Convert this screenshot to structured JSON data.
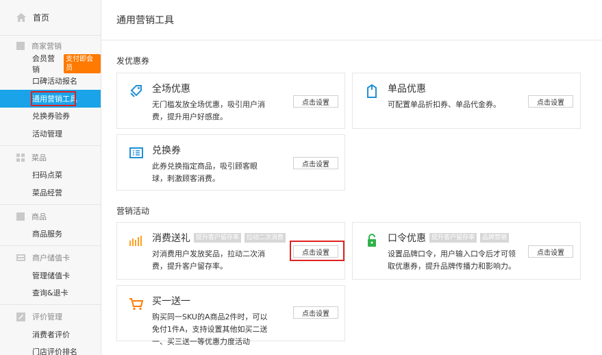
{
  "sidebar": {
    "home": "首页",
    "groups": [
      {
        "title": "商家营销",
        "items": [
          "会员营销",
          "口碑活动报名",
          "通用营销工具",
          "兑换券验券",
          "活动管理"
        ],
        "badge": "支付即会员"
      },
      {
        "title": "菜品",
        "items": [
          "扫码点菜",
          "菜品经营"
        ]
      },
      {
        "title": "商品",
        "items": [
          "商品服务"
        ]
      },
      {
        "title": "商户储值卡",
        "items": [
          "管理储值卡",
          "查询&退卡"
        ]
      },
      {
        "title": "评价管理",
        "items": [
          "消费者评价",
          "门店评价排名"
        ]
      }
    ]
  },
  "main": {
    "title": "通用营销工具",
    "sections": [
      {
        "title": "发优惠券",
        "cards": [
          {
            "title": "全场优惠",
            "desc": "无门槛发放全场优惠，吸引用户消费，提升用户好感度。",
            "button": "点击设置",
            "icon": "tag-icon"
          },
          {
            "title": "单品优惠",
            "desc": "可配置单品折扣券、单品代金券。",
            "button": "点击设置",
            "icon": "cup-icon"
          },
          {
            "title": "兑换券",
            "desc": "此券兑换指定商品，吸引顾客眼球，刺激顾客消费。",
            "button": "点击设置",
            "icon": "ticket-icon"
          }
        ]
      },
      {
        "title": "营销活动",
        "cards": [
          {
            "title": "消费送礼",
            "tags": [
              "提升客户留存率",
              "拉动二次消费"
            ],
            "desc": "对消费用户发放奖品，拉动二次消费，提升客户留存率。",
            "button": "点击设置",
            "icon": "bars-icon"
          },
          {
            "title": "口令优惠",
            "tags": [
              "提升客户留存率",
              "品牌营销"
            ],
            "desc": "设置品牌口令，用户输入口令后才可领取优惠券，提升品牌传播力和影响力。",
            "button": "点击设置",
            "icon": "lock-icon"
          },
          {
            "title": "买一送一",
            "desc": "购买同一SKU的A商品2件时，可以免付1件A，支持设置其他如买二送一、买三送一等优惠力度活动",
            "button": "点击设置",
            "icon": "cart-icon"
          }
        ]
      }
    ]
  },
  "colors": {
    "active_bg": "#1aa3e8",
    "badge": "#ff7a00",
    "highlight": "#e02020",
    "icon_blue": "#1e8fd6",
    "icon_green": "#2fb24a",
    "icon_orange": "#ff7a00"
  }
}
